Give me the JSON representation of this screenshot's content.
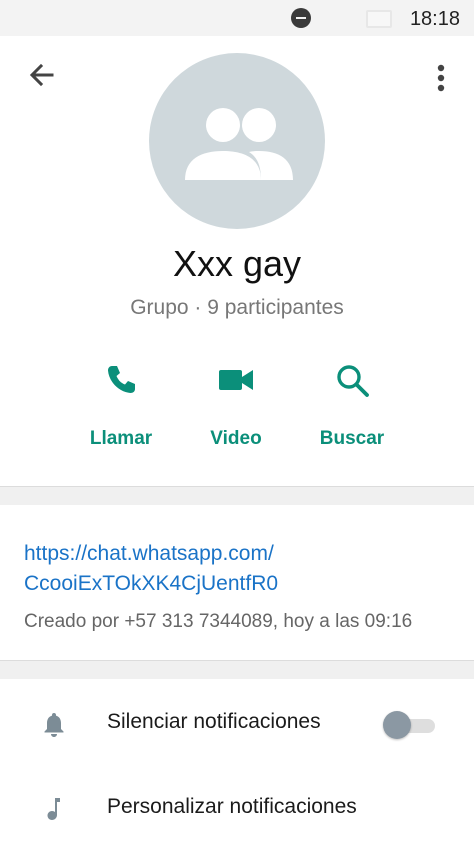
{
  "status_bar": {
    "time": "18:18"
  },
  "header": {
    "group_name": "Xxx gay",
    "group_sub": "Grupo · 9 participantes"
  },
  "actions": [
    {
      "label": "Llamar",
      "icon": "phone-icon"
    },
    {
      "label": "Video",
      "icon": "video-icon"
    },
    {
      "label": "Buscar",
      "icon": "search-icon"
    }
  ],
  "invite": {
    "link_line1": "https://chat.whatsapp.com/",
    "link_line2": "CcooiExTOkXK4CjUentfR0",
    "created": "Creado por +57 313 7344089, hoy a las 09:16"
  },
  "settings": [
    {
      "label": "Silenciar notificaciones",
      "icon": "bell-icon",
      "toggle": false
    },
    {
      "label": "Personalizar notificaciones",
      "icon": "music-note-icon"
    }
  ],
  "colors": {
    "accent": "#0b8f7a",
    "link": "#1a73c7",
    "avatar_bg": "#cfd8dc"
  }
}
